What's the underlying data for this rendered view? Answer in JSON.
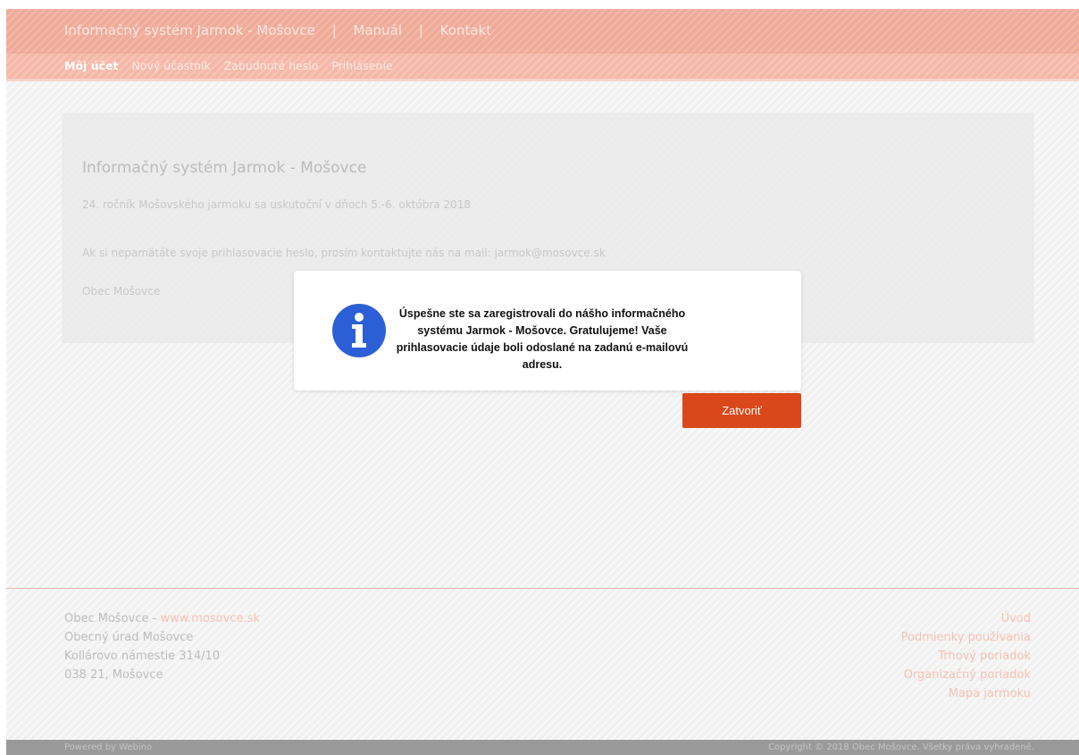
{
  "header": {
    "site_title": "Informačný systém Jarmok - Mošovce",
    "separator": "|",
    "manual": "Manuál",
    "contact": "Kontakt"
  },
  "subnav": {
    "items": [
      "Môj účet",
      "Nový účastník",
      "Zabudnuté heslo",
      "Prihlásenie"
    ],
    "active_index": 0
  },
  "content": {
    "title": "Informačný systém Jarmok - Mošovce",
    "edition_text": "24. ročník Mošovského jarmoku sa uskutoční v dňoch 5.-6. októbra 2018",
    "password_note": "Ak si nepamätáte svoje prihlasovacie heslo, prosím kontaktujte nás na mail: jarmok@mosovce.sk",
    "signature": "Obec Mošovce"
  },
  "modal": {
    "icon": "info-icon",
    "message": "Úspešne ste sa zaregistrovali do nášho informačného systému Jarmok - Mošovce. Gratulujeme! Vaše prihlasovacie údaje boli odoslané na zadanú e-mailovú adresu.",
    "close_label": "Zatvoriť"
  },
  "footer": {
    "org_name": "Obec Mošovce - ",
    "website": "www.mosovce.sk",
    "office": "Obecný úrad Mošovce",
    "street": "Kollárovo námestie 314/10",
    "city": "038 21, Mošovce",
    "links": [
      "Úvod",
      "Podmienky používania",
      "Trhový poriadok",
      "Organizačný poriadok",
      "Mapa jarmoku"
    ]
  },
  "bottom_bar": {
    "powered": "Powered by Webino",
    "copyright": "Copyright © 2018 Obec Mošovce. Všetky práva vyhradené."
  },
  "colors": {
    "header": "#efaa98",
    "accent_button": "#d9471a",
    "info_icon": "#2c5fd6"
  }
}
